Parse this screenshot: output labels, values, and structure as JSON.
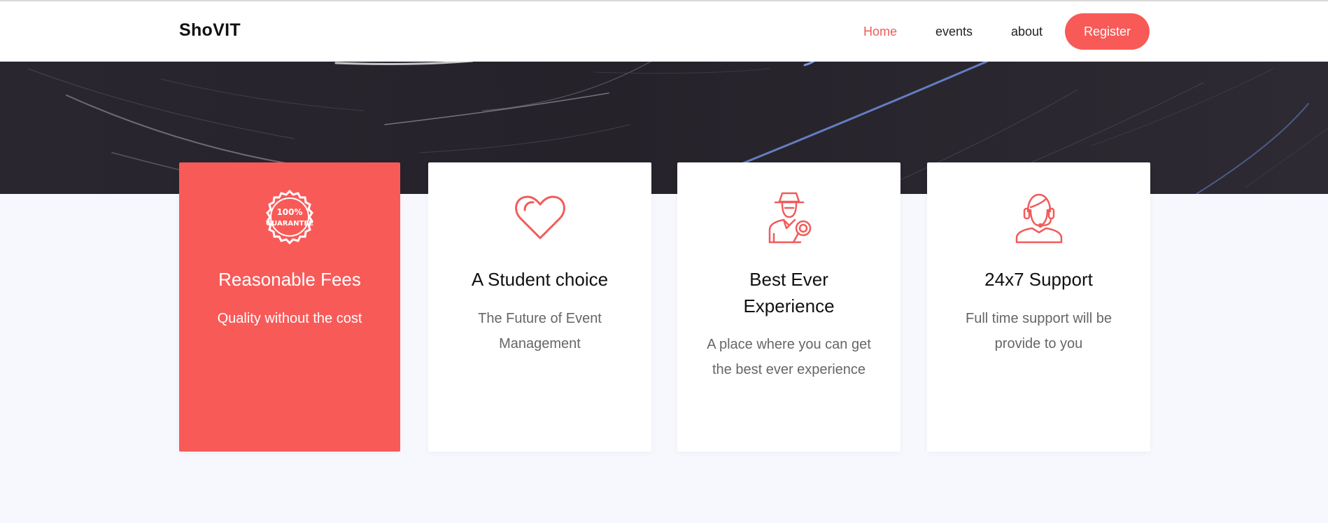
{
  "brand": "ShoVIT",
  "nav": {
    "home": "Home",
    "events": "events",
    "about": "about",
    "register": "Register"
  },
  "colors": {
    "accent": "#f85a58",
    "active_link": "#f25b5a",
    "page_bg": "#f7f8fd",
    "hero_bg": "#2a2630"
  },
  "features": [
    {
      "icon": "guarantee-badge-icon",
      "title": "Reasonable Fees",
      "text": "Quality without the cost"
    },
    {
      "icon": "heart-icon",
      "title": "A Student choice",
      "text": "The Future of Event Management"
    },
    {
      "icon": "inspector-icon",
      "title": "Best Ever Experience",
      "text": "A place where you can get the best ever experience"
    },
    {
      "icon": "headset-support-icon",
      "title": "24x7 Support",
      "text": "Full time support will be provide to you"
    }
  ],
  "badge_text": {
    "line1": "100%",
    "line2": "GUARANTEE"
  }
}
